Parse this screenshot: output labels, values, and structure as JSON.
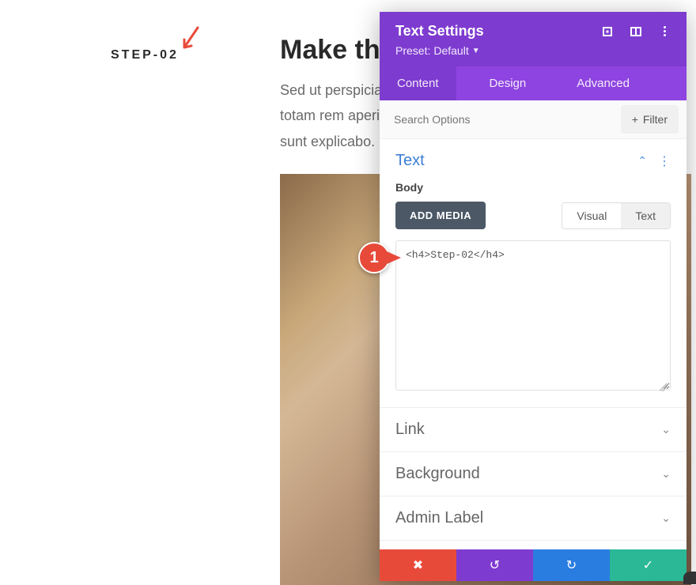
{
  "page": {
    "step_label": "STEP-02",
    "heading": "Make th",
    "paragraph_line1": "Sed ut perspiciat",
    "paragraph_line2": "totam rem aperi",
    "paragraph_line3": "sunt explicabo."
  },
  "callout": {
    "number": "1"
  },
  "panel": {
    "title": "Text Settings",
    "preset_label": "Preset:",
    "preset_value": "Default",
    "tabs": {
      "content": "Content",
      "design": "Design",
      "advanced": "Advanced"
    },
    "search_placeholder": "Search Options",
    "filter_label": "Filter",
    "sections": {
      "text": {
        "title": "Text",
        "body_label": "Body",
        "add_media": "ADD MEDIA",
        "editor_tabs": {
          "visual": "Visual",
          "text": "Text"
        },
        "editor_content": "<h4>Step-02</h4>"
      },
      "link": {
        "title": "Link"
      },
      "background": {
        "title": "Background"
      },
      "admin_label": {
        "title": "Admin Label"
      }
    }
  }
}
